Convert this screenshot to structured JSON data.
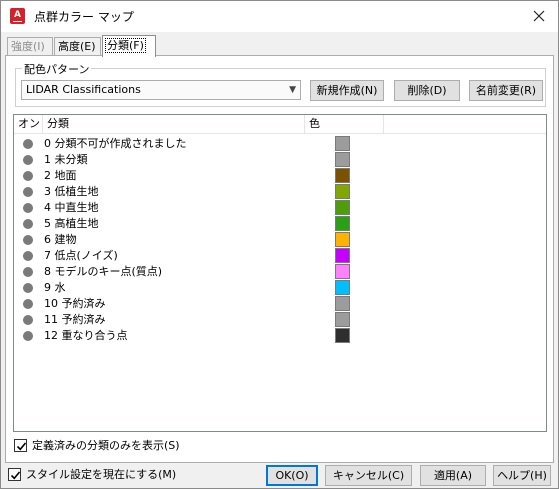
{
  "window": {
    "title": "点群カラー マップ",
    "app_icon_letter": "A"
  },
  "tabs": [
    {
      "label": "強度(I)",
      "state": "disabled"
    },
    {
      "label": "高度(E)",
      "state": "normal"
    },
    {
      "label": "分類(F)",
      "state": "active"
    }
  ],
  "scheme": {
    "legend": "配色パターン",
    "selected": "LIDAR Classifications",
    "new_label": "新規作成(N)",
    "delete_label": "削除(D)",
    "rename_label": "名前変更(R)"
  },
  "table": {
    "headers": [
      "オン",
      "分類",
      "色"
    ],
    "rows": [
      {
        "label": "0 分類不可が作成されました",
        "color": "#9c9c9c"
      },
      {
        "label": "1 未分類",
        "color": "#9c9c9c"
      },
      {
        "label": "2 地面",
        "color": "#7a5200"
      },
      {
        "label": "3 低植生地",
        "color": "#80a800"
      },
      {
        "label": "4 中直生地",
        "color": "#4e9e0c"
      },
      {
        "label": "5 高植生地",
        "color": "#2aa014"
      },
      {
        "label": "6 建物",
        "color": "#ffb300"
      },
      {
        "label": "7 低点(ノイズ)",
        "color": "#c400ff"
      },
      {
        "label": "8 モデルのキー点(質点)",
        "color": "#ff80ff"
      },
      {
        "label": "9 水",
        "color": "#00bfff"
      },
      {
        "label": "10 予約済み",
        "color": "#9c9c9c"
      },
      {
        "label": "11 予約済み",
        "color": "#9c9c9c"
      },
      {
        "label": "12 重なり合う点",
        "color": "#2e2e2e"
      }
    ]
  },
  "show_defined_label": "定義済みの分類のみを表示(S)",
  "show_defined_checked": true,
  "style_current_label": "スタイル設定を現在にする(M)",
  "style_current_checked": true,
  "buttons": {
    "ok": "OK(O)",
    "cancel": "キャンセル(C)",
    "apply": "適用(A)",
    "help": "ヘルプ(H)"
  }
}
